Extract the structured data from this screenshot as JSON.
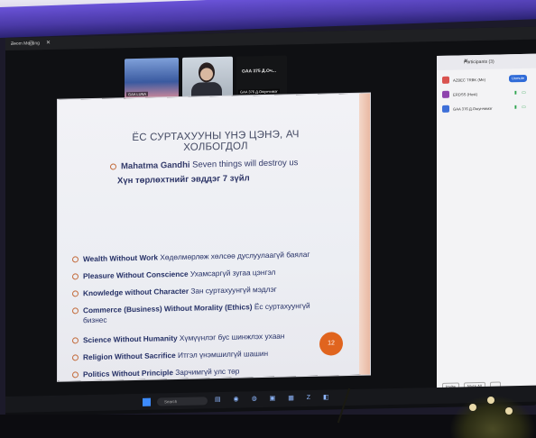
{
  "window": {
    "title": "Zoom Meeting",
    "controls": "— ▢ ✕"
  },
  "participants_strip": [
    {
      "name": "GAA LUNA"
    },
    {
      "name": ""
    },
    {
      "name": "GAA 375 Д.Оч...",
      "sub": "GAA 376 Д.Оюунчимэг"
    }
  ],
  "slide": {
    "title": "ЁС СУРТАХУУНЫ ҮНЭ ЦЭНЭ, АЧ ХОЛБОГДОЛ",
    "gandhi_name": "Mahatma Gandhi",
    "gandhi_text": " Seven things will destroy us",
    "gandhi_mn": "Хүн төрлөхтнийг эвддэг 7 зүйл",
    "bullets": [
      {
        "en": "Wealth Without Work",
        "mn": " Хөдөлмөрлөж хөлсөө дуслуулаагүй баялаг"
      },
      {
        "en": "Pleasure Without Conscience",
        "mn": " Ухамсаргүй зугаа цэнгэл"
      },
      {
        "en": "Knowledge without Character",
        "mn": " Зан суртахуунгүй мэдлэг"
      },
      {
        "en": "Commerce (Business) Without Morality (Ethics)",
        "mn": " Ёс суртахуунгүй",
        "mn2": "бизнес"
      },
      {
        "en": "Science Without Humanity",
        "mn": " Хүмүүнлэг бус шинжлэх ухаан"
      },
      {
        "en": "Religion Without Sacrifice",
        "mn": " Итгэл үнэмшилгүй шашин"
      },
      {
        "en": "Politics Without Principle",
        "mn": " Зарчимгүй улс төр"
      }
    ],
    "page_number": "12"
  },
  "panel": {
    "title": "Participants (3)",
    "rows": [
      {
        "name": "AZBEC TRBK (Me)",
        "action": "Unmute",
        "avatar_color": "#d9534f"
      },
      {
        "name": "ERDSS (Host)",
        "avatar_color": "#8e44ad"
      },
      {
        "name": "GAA 376 Д.Оюунчимэг",
        "avatar_color": "#3d6fd8"
      }
    ],
    "footer_invite": "Invite",
    "footer_mute": "Mute All",
    "footer_more": "..."
  },
  "taskbar": {
    "search": "Search",
    "icons": "▤ ◉ ◍ ▣ ▦ Z ◧"
  },
  "colors": {
    "accent": "#e0641e",
    "panel_blue": "#2f6bd8",
    "ceiling_band": "#5a45c7"
  }
}
